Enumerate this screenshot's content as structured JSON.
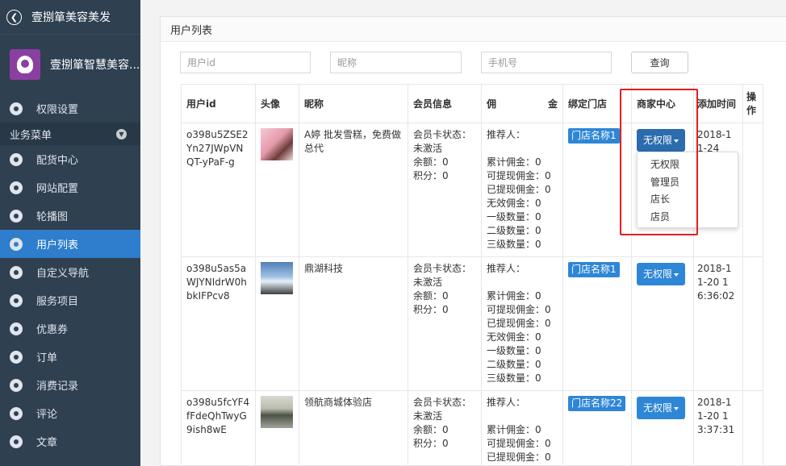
{
  "sidebar": {
    "back_title": "壹捌箪美容美发",
    "profile_name": "壹捌箪智慧美容...",
    "top_item": "权限设置",
    "section_label": "业务菜单",
    "items": [
      {
        "label": "配货中心"
      },
      {
        "label": "网站配置"
      },
      {
        "label": "轮播图"
      },
      {
        "label": "用户列表",
        "active": true
      },
      {
        "label": "自定义导航"
      },
      {
        "label": "服务项目"
      },
      {
        "label": "优惠券"
      },
      {
        "label": "订单"
      },
      {
        "label": "消费记录"
      },
      {
        "label": "评论"
      },
      {
        "label": "文章"
      }
    ]
  },
  "panel": {
    "title": "用户列表",
    "search": {
      "uid_placeholder": "用户id",
      "nick_placeholder": "昵称",
      "phone_placeholder": "手机号",
      "button": "查询"
    }
  },
  "table": {
    "headers": {
      "uid": "用户id",
      "avatar": "头像",
      "nick": "昵称",
      "member": "会员信息",
      "money_left": "佣",
      "money_right": "金",
      "store": "绑定门店",
      "merchant": "商家中心",
      "time": "添加时间",
      "op": "操作"
    },
    "rows": [
      {
        "uid": "o398u5ZSE2Yn27JWpVNQT-yPaF-g",
        "nick": "A婷 批发雪糕，免费做总代",
        "member": [
          "会员卡状态：",
          "未激活",
          "余额：0",
          "积分：0"
        ],
        "money": [
          "推荐人：",
          "",
          "累计佣金：0",
          "可提现佣金：0",
          "已提现佣金：0",
          "无效佣金：0",
          "一级数量：0",
          "二级数量：0",
          "三级数量：0"
        ],
        "store": "门店名称1",
        "perm": "无权限",
        "time": "2018-11-24"
      },
      {
        "uid": "o398u5as5aWJYNIdrW0hbkIFPcv8",
        "nick": "鼎湖科技",
        "member": [
          "会员卡状态：",
          "未激活",
          "余额：0",
          "积分：0"
        ],
        "money": [
          "推荐人：",
          "",
          "累计佣金：0",
          "可提现佣金：0",
          "已提现佣金：0",
          "无效佣金：0",
          "一级数量：0",
          "二级数量：0",
          "三级数量：0"
        ],
        "store": "门店名称1",
        "perm": "无权限",
        "time": "2018-11-20 16:36:02"
      },
      {
        "uid": "o398u5fcYF4fFdeQhTwyG9ish8wE",
        "nick": "领航商城体验店",
        "member": [
          "会员卡状态：",
          "未激活",
          "余额：0",
          "积分：0"
        ],
        "money": [
          "推荐人：",
          "",
          "累计佣金：0",
          "可提现佣金：0",
          "已提现佣金：0"
        ],
        "store": "门店名称22",
        "perm": "无权限",
        "time": "2018-11-20 13:37:31"
      }
    ]
  },
  "dropdown": {
    "options": [
      "无权限",
      "管理员",
      "店长",
      "店员"
    ]
  }
}
